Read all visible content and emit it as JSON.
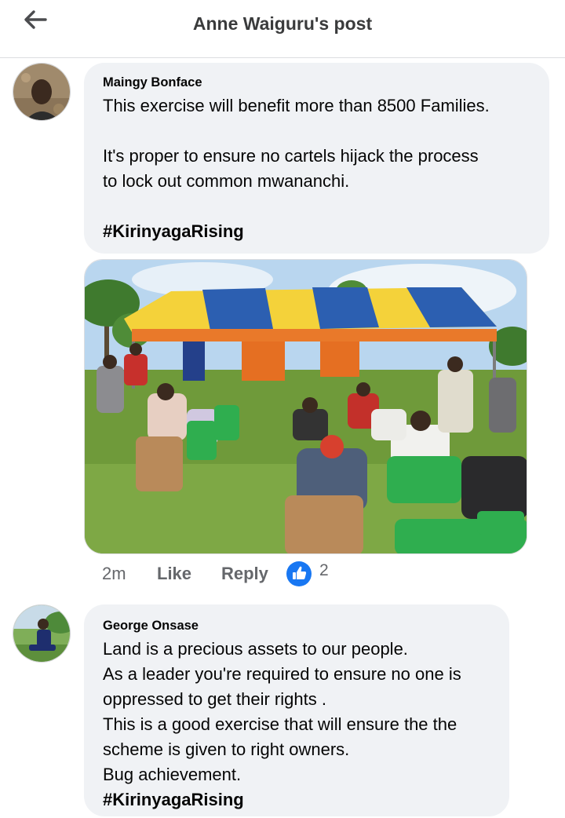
{
  "header": {
    "title": "Anne Waiguru's post",
    "back_icon": "back-arrow-icon"
  },
  "comments": [
    {
      "author": "Maingy Bonface",
      "lines": [
        "This exercise will benefit more than 8500 Families.",
        "It's proper to ensure no cartels hijack the process",
        "to lock out common mwananchi.",
        "#KirinyagaRising"
      ],
      "actions": {
        "time": "2m",
        "like_label": "Like",
        "reply_label": "Reply",
        "reaction_icon": "thumbs-up-icon",
        "reaction_count": "2"
      }
    },
    {
      "author": "George Onsase",
      "lines": [
        "Land is a precious assets to our people.",
        "As a leader you're required to ensure no one is",
        "oppressed to get their rights .",
        "This is a good exercise that will ensure the the",
        "scheme is given to right owners.",
        "Bug achievement.",
        "#KirinyagaRising"
      ]
    }
  ],
  "colors": {
    "bubble_bg": "#f0f2f5",
    "meta_text": "#65676b",
    "like_blue": "#1877f2"
  }
}
